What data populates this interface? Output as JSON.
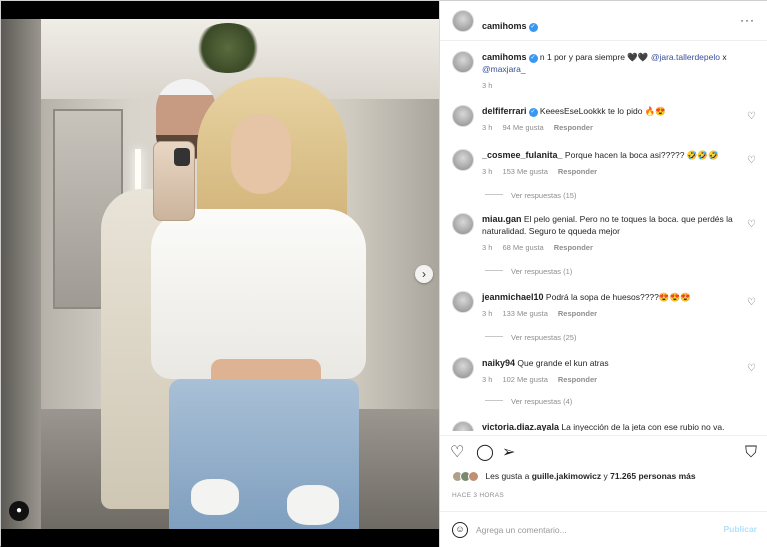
{
  "post": {
    "username": "camihoms",
    "more_icon": "···",
    "caption": {
      "username": "camihoms",
      "text_before": "n 1 por y para siempre 🖤🖤",
      "mention1": "@jara.tallerdepelo",
      "connector": " x ",
      "mention2": "@maxjara_",
      "age": "3 h"
    }
  },
  "comments": [
    {
      "user": "delfiferrari",
      "verified": true,
      "text": "KeeesEseLookkk te lo pido 🔥😍",
      "age": "3 h",
      "likes": "94 Me gusta",
      "reply": "Responder"
    },
    {
      "user": "_cosmee_fulanita_",
      "verified": false,
      "text": "Porque hacen la boca asi????? 🤣🤣🤣",
      "age": "3 h",
      "likes": "153 Me gusta",
      "reply": "Responder",
      "replies": "Ver respuestas (15)"
    },
    {
      "user": "miau.gan",
      "verified": false,
      "text": "El pelo genial. Pero no te toques la boca. que perdés la naturalidad. Seguro te qqueda mejor",
      "age": "3 h",
      "likes": "68 Me gusta",
      "reply": "Responder",
      "replies": "Ver respuestas (1)"
    },
    {
      "user": "jeanmichael10",
      "verified": false,
      "text": "Podrá la sopa de huesos????😍😍😍",
      "age": "3 h",
      "likes": "133 Me gusta",
      "reply": "Responder",
      "replies": "Ver respuestas (25)"
    },
    {
      "user": "naiky94",
      "verified": false,
      "text": "Que grande el kun atras",
      "age": "3 h",
      "likes": "102 Me gusta",
      "reply": "Responder",
      "replies": "Ver respuestas (4)"
    },
    {
      "user": "victoria.diaz.ayala",
      "verified": false,
      "text": "La inyección de la jeta con ese rubio no va.",
      "age": "",
      "likes": "",
      "reply": ""
    }
  ],
  "likes_line": {
    "prefix": "Les gusta a ",
    "user": "guille.jakimowicz",
    "middle": " y ",
    "count": "71.265 personas más"
  },
  "timestamp": "HACE 3 HORAS",
  "add_comment": {
    "placeholder": "Agrega un comentario...",
    "post_label": "Publicar"
  },
  "colors": {
    "verified": "#3897f0",
    "mention": "#3a4f9c",
    "post_disabled": "#b2dffc"
  }
}
